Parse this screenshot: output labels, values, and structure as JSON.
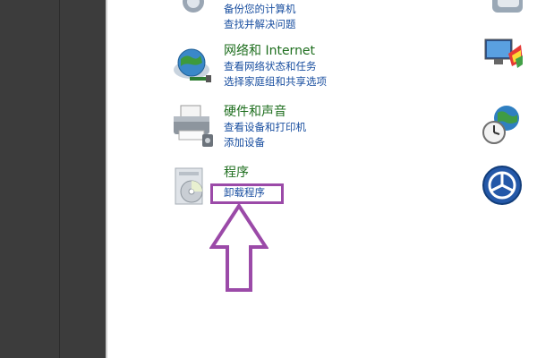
{
  "categories": [
    {
      "id": "system",
      "icon": "system-security-icon",
      "links": [
        "备份您的计算机",
        "查找并解决问题"
      ]
    },
    {
      "id": "network",
      "icon": "network-globe-icon",
      "title": "网络和 Internet",
      "links": [
        "查看网络状态和任务",
        "选择家庭组和共享选项"
      ]
    },
    {
      "id": "hardware",
      "icon": "printer-icon",
      "title": "硬件和声音",
      "links": [
        "查看设备和打印机",
        "添加设备"
      ]
    },
    {
      "id": "programs",
      "icon": "programs-disc-icon",
      "title": "程序",
      "links": [
        "卸载程序"
      ]
    }
  ],
  "right_column_icons": [
    "user-accounts-icon",
    "appearance-icon",
    "clock-globe-icon",
    "ease-of-access-icon"
  ],
  "annotation": {
    "color": "#9b4aa8",
    "target": "uninstall-program-link"
  },
  "colors": {
    "category_title": "#1e6e1e",
    "link": "#1a4fa0",
    "left_panel": "#3c3c3c"
  }
}
